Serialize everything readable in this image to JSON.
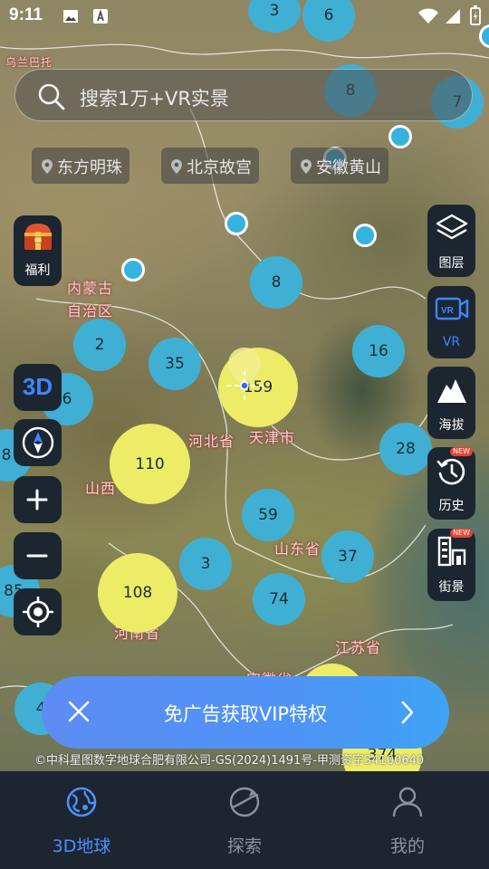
{
  "status_bar": {
    "time": "9:11"
  },
  "search": {
    "placeholder": "搜索1万+VR实景"
  },
  "quick_chips": [
    "东方明珠",
    "北京故宫",
    "安徽黄山"
  ],
  "left_panel": {
    "welfare_label": "福利",
    "mode_3d_label": "3D"
  },
  "right_panel": [
    {
      "label": "图层",
      "icon": "layers-icon",
      "badge": ""
    },
    {
      "label": "VR",
      "icon": "vr-icon",
      "badge": ""
    },
    {
      "label": "海拔",
      "icon": "mountain-icon",
      "badge": ""
    },
    {
      "label": "历史",
      "icon": "history-icon",
      "badge": "NEW"
    },
    {
      "label": "街景",
      "icon": "street-view-icon",
      "badge": "NEW"
    }
  ],
  "map_labels": {
    "wulanchabu": "乌兰巴托",
    "inner_mongolia": "内蒙古自治区",
    "hebei": "河北省",
    "tianjin": "天津市",
    "shanxi": "山西",
    "shandong": "山东省",
    "henan": "河南省",
    "jiangsu": "江苏省",
    "anhui": "安徽省"
  },
  "clusters": {
    "c1": "3",
    "c2": "6",
    "c3": "8",
    "c4": "7",
    "c5": "8",
    "c6": "2",
    "c7": "35",
    "c8": "159",
    "c9": "16",
    "c10": "6",
    "c11": "110",
    "c12": "28",
    "c13": "8",
    "c14": "59",
    "c15": "37",
    "c16": "3",
    "c17": "108",
    "c18": "74",
    "c19": "85",
    "c20": "4",
    "c21": "374"
  },
  "vip_banner": {
    "text": "免广告获取VIP特权"
  },
  "copyright": "©中科星图数字地球合肥有限公司-GS(2024)1491号-甲测资字34100640",
  "bottom_nav": [
    {
      "label": "3D地球",
      "active": true
    },
    {
      "label": "探索",
      "active": false
    },
    {
      "label": "我的",
      "active": false
    }
  ],
  "colors": {
    "accent": "#4a90ff",
    "cluster_blue": "#3fb0d4",
    "cluster_yellow": "#ecec66",
    "vip_gradient": "#5d8cf3",
    "panel_bg": "#1c2630"
  }
}
